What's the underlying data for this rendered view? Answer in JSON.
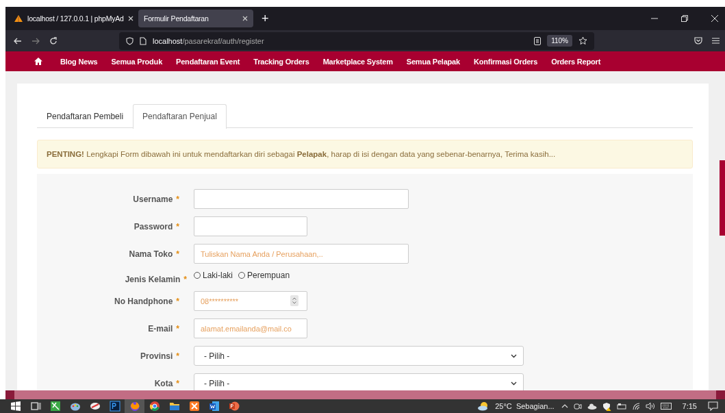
{
  "browser": {
    "tabs": [
      {
        "title": "localhost / 127.0.0.1 | phpMyAd",
        "selected": false
      },
      {
        "title": "Formulir Pendaftaran",
        "selected": true
      }
    ],
    "new_tab": "+",
    "url": {
      "host": "localhost",
      "path": "/pasarekraf/auth/register"
    },
    "zoom": "110%"
  },
  "nav": {
    "items": [
      {
        "label": "Blog News"
      },
      {
        "label": "Semua Produk"
      },
      {
        "label": "Pendaftaran Event"
      },
      {
        "label": "Tracking Orders"
      },
      {
        "label": "Marketplace System"
      },
      {
        "label": "Semua Pelapak"
      },
      {
        "label": "Konfirmasi Orders"
      },
      {
        "label": "Orders Report"
      }
    ]
  },
  "form_tabs": [
    {
      "label": "Pendaftaran Pembeli",
      "selected": false
    },
    {
      "label": "Pendaftaran Penjual",
      "selected": true
    }
  ],
  "alert": "**PENTING!** Lengkapi Form dibawah ini untuk mendaftarkan diri sebagai **Pelapak**, harap di isi dengan data yang sebenar-benarnya, Terima kasih...",
  "fields": [
    {
      "kind": "longtext",
      "label": "Username",
      "asterisk": "*"
    },
    {
      "kind": "text",
      "label": "Password",
      "asterisk": "*"
    },
    {
      "kind": "longtext",
      "label": "Nama Toko",
      "asterisk": "*",
      "placeholder": "Tuliskan Nama Anda / Perusahaan,.."
    },
    {
      "kind": "radio",
      "label": "Jenis Kelamin",
      "asterisk": "*",
      "options": [
        {
          "label": "Laki-laki",
          "selected": false
        },
        {
          "label": "Perempuan",
          "selected": false
        }
      ]
    },
    {
      "kind": "number",
      "label": "No Handphone",
      "asterisk": "*",
      "placeholder": "08**********"
    },
    {
      "kind": "text",
      "label": "E-mail",
      "asterisk": "*",
      "placeholder": "alamat.emailanda@mail.co"
    },
    {
      "kind": "select",
      "label": "Provinsi",
      "asterisk": "*",
      "value": "- Pilih -"
    },
    {
      "kind": "select",
      "label": "Kota",
      "asterisk": "*",
      "value": "- Pilih -"
    }
  ],
  "taskbar": {
    "apps": [
      {
        "kind": "start",
        "selected": false
      },
      {
        "kind": "taskview",
        "selected": false
      },
      {
        "kind": "green",
        "selected": false
      },
      {
        "kind": "paint",
        "selected": false
      },
      {
        "kind": "tool",
        "selected": false
      },
      {
        "kind": "ps",
        "selected": false
      },
      {
        "kind": "firefox",
        "selected": true
      },
      {
        "kind": "chrome",
        "selected": false
      },
      {
        "kind": "folder",
        "selected": false
      },
      {
        "kind": "xampp",
        "selected": false
      },
      {
        "kind": "word",
        "selected": false
      },
      {
        "kind": "ppt",
        "selected": false
      }
    ],
    "weather": "25°C  Sebagian...",
    "time": "7:15"
  }
}
